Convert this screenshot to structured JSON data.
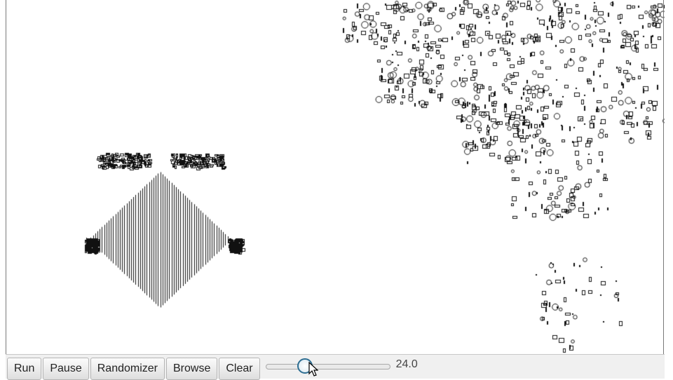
{
  "toolbar": {
    "run_label": "Run",
    "pause_label": "Pause",
    "randomizer_label": "Randomizer",
    "browse_label": "Browse",
    "clear_label": "Clear"
  },
  "speed": {
    "value_text": "24.0",
    "fraction": 0.24
  },
  "colors": {
    "cell": "#111111",
    "background": "#ffffff",
    "toolbar": "#f0f0f0",
    "slider_thumb": "#2d6d91"
  },
  "icons": {
    "cursor": "mouse-pointer-icon"
  }
}
